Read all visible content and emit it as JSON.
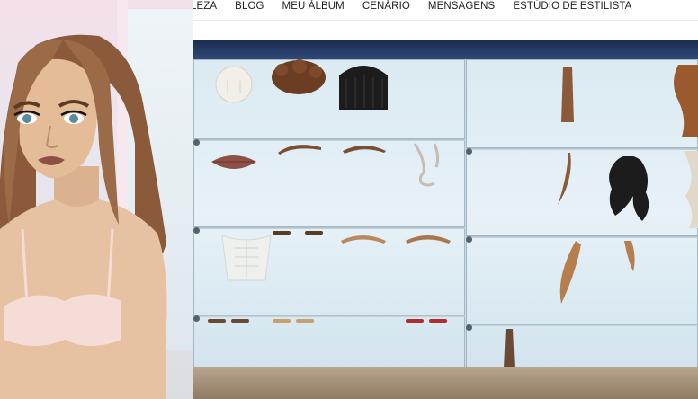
{
  "nav": {
    "cut_text": "· · ¸ ¸",
    "items": [
      {
        "label": "LEZA"
      },
      {
        "label": "BLOG"
      },
      {
        "label": "MEU ÁLBUM"
      },
      {
        "label": "CENÁRIO"
      },
      {
        "label": "MENSAGENS"
      },
      {
        "label": "ESTÚDIO DE ESTILISTA"
      }
    ]
  },
  "colors": {
    "hair_brown": "#8a5a3a",
    "hair_black": "#1c1c1c",
    "lips": "#8e4f45",
    "brow": "#7a4e32",
    "skin": "#e7c2a2",
    "bra": "#f6dcd6"
  },
  "wardrobe": {
    "left_panel": [
      {
        "name": "face-skin-item"
      },
      {
        "name": "afro-hair-item"
      },
      {
        "name": "black-bob-hair-item"
      },
      {
        "name": "lips-item"
      },
      {
        "name": "eyebrows-item-1"
      },
      {
        "name": "eyebrows-item-2"
      },
      {
        "name": "nose-item"
      },
      {
        "name": "abs-body-item"
      },
      {
        "name": "thin-brows-item"
      },
      {
        "name": "light-brows-item-1"
      },
      {
        "name": "light-brows-item-2"
      },
      {
        "name": "brow-strip-item"
      }
    ],
    "right_panel": [
      {
        "name": "long-brown-hair-item"
      },
      {
        "name": "wavy-brown-hair-item"
      },
      {
        "name": "side-strand-hair-item"
      },
      {
        "name": "black-wavy-hair-item"
      },
      {
        "name": "light-strand-hair-item"
      },
      {
        "name": "blonde-strand-hair-item-1"
      },
      {
        "name": "blonde-strand-hair-item-2"
      },
      {
        "name": "long-dark-hair-item"
      }
    ]
  }
}
